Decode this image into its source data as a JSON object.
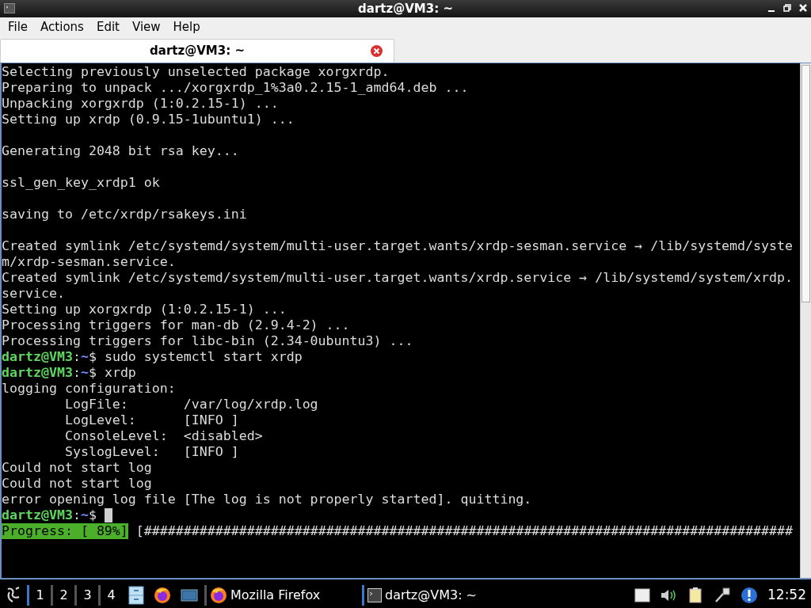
{
  "window": {
    "title": "dartz@VM3: ~"
  },
  "menu": [
    "File",
    "Actions",
    "Edit",
    "View",
    "Help"
  ],
  "tabs": [
    {
      "label": "dartz@VM3: ~",
      "selected": true
    }
  ],
  "terminal": {
    "lines": [
      {
        "kind": "text",
        "text": "Selecting previously unselected package xorgxrdp."
      },
      {
        "kind": "text",
        "text": "Preparing to unpack .../xorgxrdp_1%3a0.2.15-1_amd64.deb ..."
      },
      {
        "kind": "text",
        "text": "Unpacking xorgxrdp (1:0.2.15-1) ..."
      },
      {
        "kind": "text",
        "text": "Setting up xrdp (0.9.15-1ubuntu1) ..."
      },
      {
        "kind": "blank"
      },
      {
        "kind": "text",
        "text": "Generating 2048 bit rsa key..."
      },
      {
        "kind": "blank"
      },
      {
        "kind": "text",
        "text": "ssl_gen_key_xrdp1 ok"
      },
      {
        "kind": "blank"
      },
      {
        "kind": "text",
        "text": "saving to /etc/xrdp/rsakeys.ini"
      },
      {
        "kind": "blank"
      },
      {
        "kind": "text",
        "text": "Created symlink /etc/systemd/system/multi-user.target.wants/xrdp-sesman.service → /lib/systemd/syste"
      },
      {
        "kind": "text",
        "text": "m/xrdp-sesman.service."
      },
      {
        "kind": "text",
        "text": "Created symlink /etc/systemd/system/multi-user.target.wants/xrdp.service → /lib/systemd/system/xrdp."
      },
      {
        "kind": "text",
        "text": "service."
      },
      {
        "kind": "text",
        "text": "Setting up xorgxrdp (1:0.2.15-1) ..."
      },
      {
        "kind": "text",
        "text": "Processing triggers for man-db (2.9.4-2) ..."
      },
      {
        "kind": "text",
        "text": "Processing triggers for libc-bin (2.34-0ubuntu3) ..."
      },
      {
        "kind": "prompt",
        "user": "dartz@VM3",
        "colon": ":",
        "path": "~",
        "command": "$ sudo systemctl start xrdp",
        "cursor": false
      },
      {
        "kind": "prompt",
        "user": "dartz@VM3",
        "colon": ":",
        "path": "~",
        "command": "$ xrdp",
        "cursor": false
      },
      {
        "kind": "text",
        "text": "logging configuration:"
      },
      {
        "kind": "text",
        "text": "        LogFile:       /var/log/xrdp.log"
      },
      {
        "kind": "text",
        "text": "        LogLevel:      [INFO ]"
      },
      {
        "kind": "text",
        "text": "        ConsoleLevel:  <disabled>"
      },
      {
        "kind": "text",
        "text": "        SyslogLevel:   [INFO ]"
      },
      {
        "kind": "text",
        "text": "Could not start log"
      },
      {
        "kind": "text",
        "text": "Could not start log"
      },
      {
        "kind": "text",
        "text": "error opening log file [The log is not properly started]. quitting."
      },
      {
        "kind": "prompt",
        "user": "dartz@VM3",
        "colon": ":",
        "path": "~",
        "command": "$",
        "cursor": true
      },
      {
        "kind": "progress",
        "label": "Progress: [ 89%]",
        "bar": "[##################################################################################"
      }
    ]
  },
  "taskbar": {
    "workspaces": [
      "1",
      "2",
      "3",
      "4"
    ],
    "tasks": [
      {
        "kind": "firefox",
        "label": "Mozilla Firefox"
      },
      {
        "kind": "terminal",
        "label": "dartz@VM3: ~"
      }
    ],
    "clock": "12:52"
  }
}
